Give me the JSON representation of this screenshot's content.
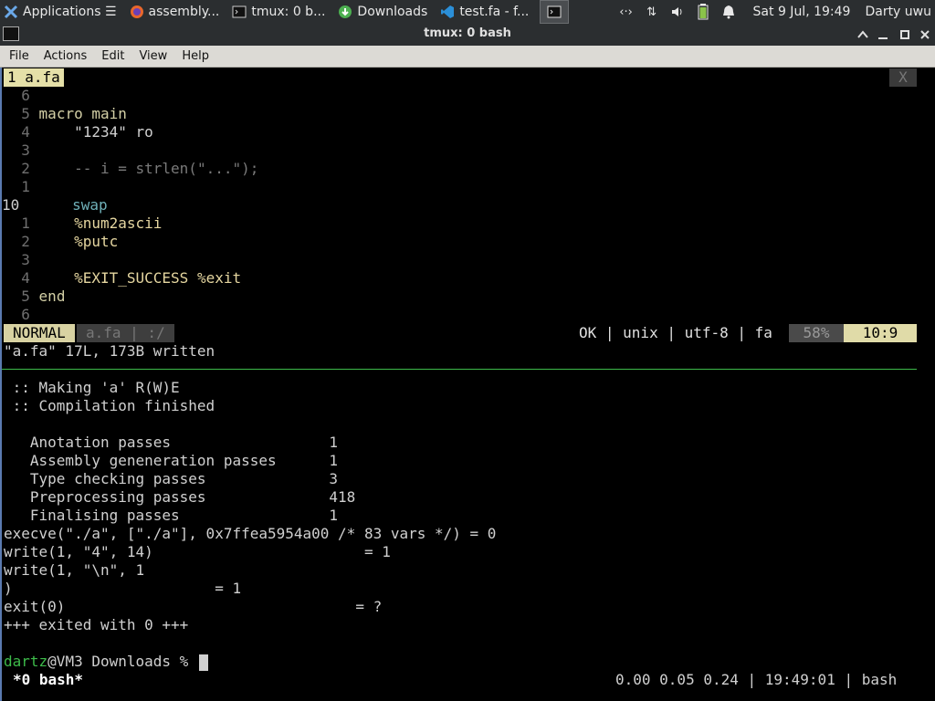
{
  "panel": {
    "tasks": [
      {
        "label": "Applications ☰",
        "icon": "xfce-logo-icon"
      },
      {
        "label": "assembly...",
        "icon": "firefox-icon"
      },
      {
        "label": "tmux: 0 b...",
        "icon": "terminal-icon"
      },
      {
        "label": "Downloads",
        "icon": "download-icon"
      },
      {
        "label": "test.fa - f...",
        "icon": "vscode-icon"
      },
      {
        "label": "",
        "icon": "terminal-icon"
      }
    ],
    "clock": "Sat  9 Jul, 19:49",
    "user": "Darty uwu"
  },
  "window": {
    "title": "tmux: 0 bash"
  },
  "menubar": {
    "items": [
      "File",
      "Actions",
      "Edit",
      "View",
      "Help"
    ]
  },
  "vim": {
    "tab_label": "1 a.fa",
    "tab_close": "X",
    "lines": [
      {
        "num": "  6",
        "text": ""
      },
      {
        "num": "  5",
        "text": "macro main"
      },
      {
        "num": "  4",
        "text": "    \"1234\" ro"
      },
      {
        "num": "  3",
        "text": ""
      },
      {
        "num": "  2",
        "text": "    -- i = strlen(\"...\");"
      },
      {
        "num": "  1",
        "text": ""
      },
      {
        "num": "10 ",
        "text": "    swap"
      },
      {
        "num": "  1",
        "text": "    %num2ascii"
      },
      {
        "num": "  2",
        "text": "    %putc"
      },
      {
        "num": "  3",
        "text": ""
      },
      {
        "num": "  4",
        "text": "    %EXIT_SUCCESS %exit"
      },
      {
        "num": "  5",
        "text": "end"
      },
      {
        "num": "  6",
        "text": ""
      }
    ],
    "status": {
      "mode": "NORMAL",
      "file": "a.fa | :/",
      "info": "OK | unix | utf-8 | fa",
      "percent": "58%",
      "position": "10:9"
    },
    "message": "\"a.fa\" 17L, 173B written"
  },
  "shell": {
    "lines": [
      " :: Making 'a' R(W)E",
      " :: Compilation finished",
      "",
      "   Anotation passes                  1",
      "   Assembly geneneration passes      1",
      "   Type checking passes              3",
      "   Preprocessing passes              418",
      "   Finalising passes                 1",
      "execve(\"./a\", [\"./a\"], 0x7ffea5954a00 /* 83 vars */) = 0",
      "write(1, \"4\", 14)                        = 1",
      "write(1, \"\\n\", 1",
      ")                       = 1",
      "exit(0)                                 = ?",
      "+++ exited with 0 +++"
    ],
    "prompt_user": "dartz",
    "prompt_rest": "@VM3 Downloads % "
  },
  "tmux": {
    "window_label": "*0 bash*",
    "right": "0.00 0.05 0.24 | 19:49:01 | bash"
  }
}
